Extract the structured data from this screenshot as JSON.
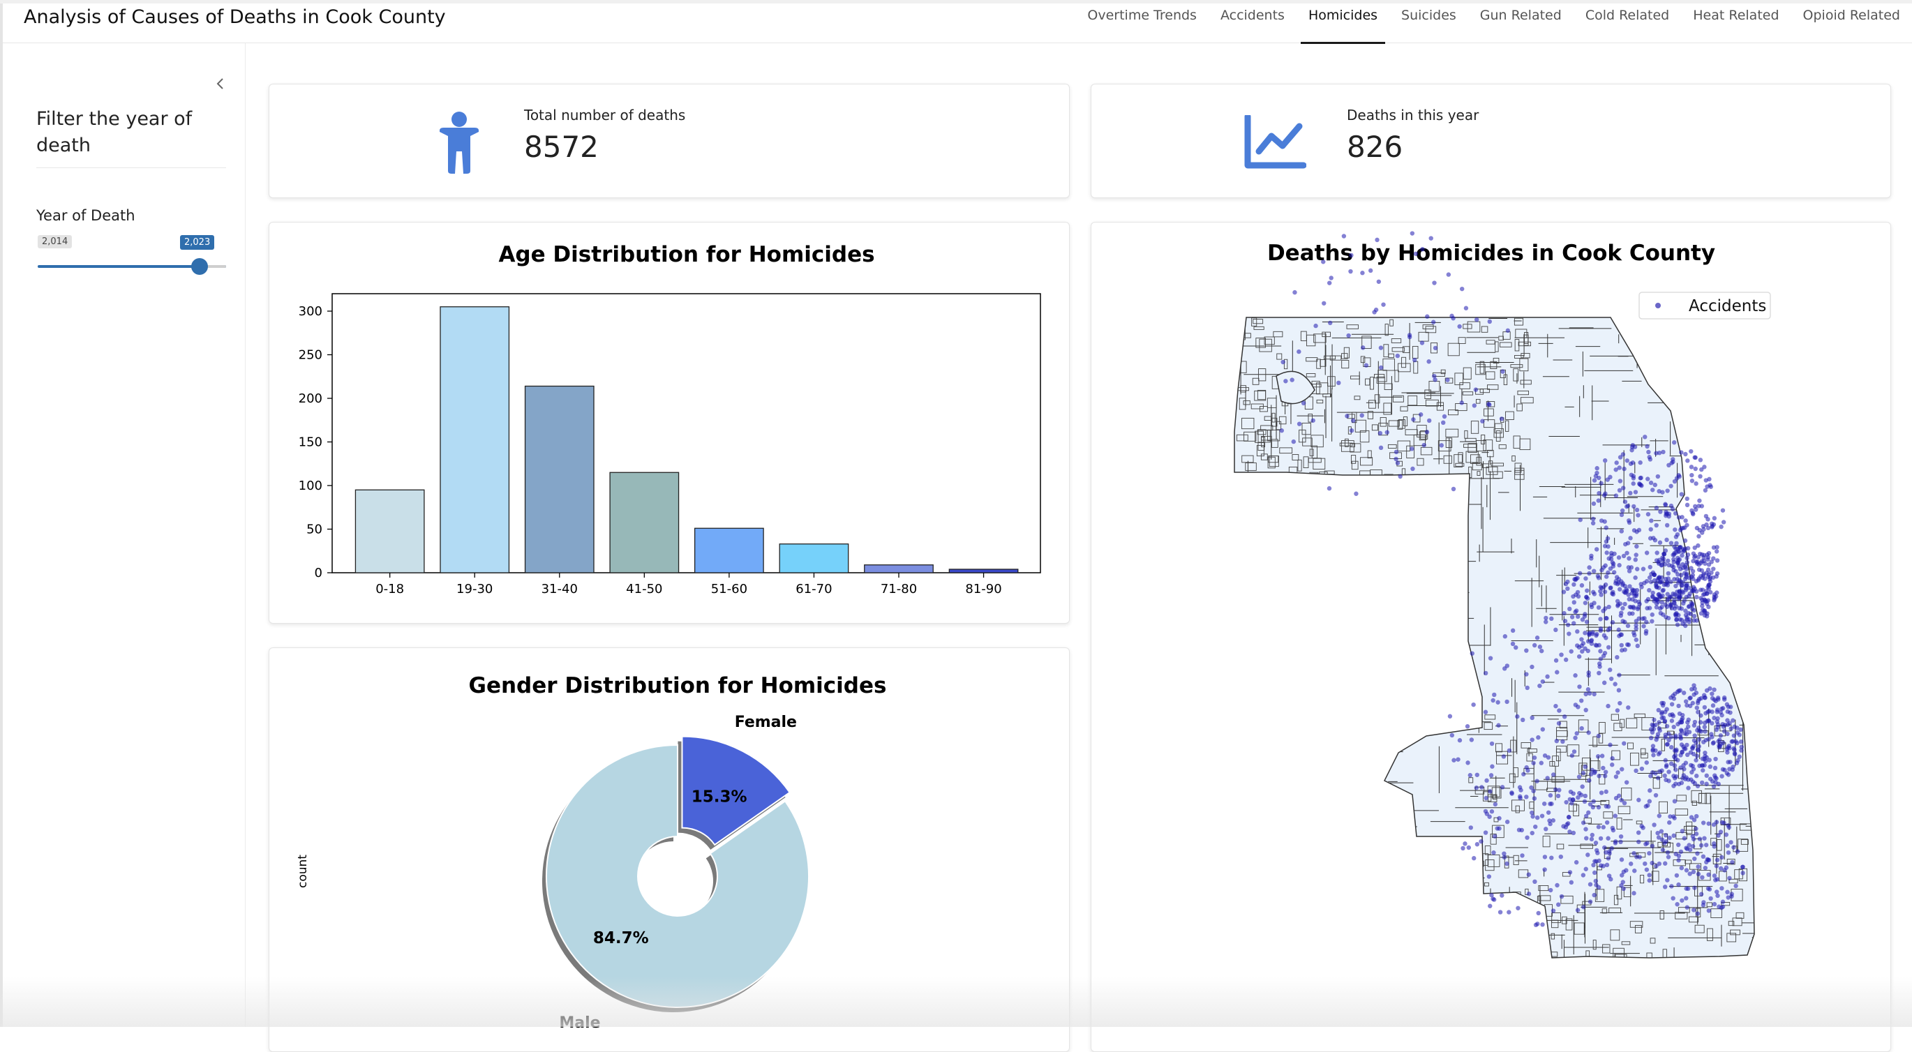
{
  "app": {
    "title": "Analysis of Causes of Deaths in Cook County"
  },
  "nav": {
    "tabs": [
      {
        "label": "Overtime Trends"
      },
      {
        "label": "Accidents"
      },
      {
        "label": "Homicides"
      },
      {
        "label": "Suicides"
      },
      {
        "label": "Gun Related"
      },
      {
        "label": "Cold Related"
      },
      {
        "label": "Heat Related"
      },
      {
        "label": "Opioid Related"
      }
    ],
    "active_tab": "Homicides"
  },
  "sidebar": {
    "collapse_icon": "chevron-left-icon",
    "title": "Filter the year of death",
    "slider": {
      "label": "Year of Death",
      "min_label": "2,014",
      "max_label": "2,023",
      "value": 2023,
      "min": 2014,
      "max": 2023
    }
  },
  "kpis": {
    "total": {
      "label": "Total number of deaths",
      "value": "8572",
      "icon": "person-icon"
    },
    "year": {
      "label": "Deaths in this year",
      "value": "826",
      "icon": "line-chart-icon"
    }
  },
  "colors": {
    "accent": "#2f6ead",
    "icon_blue": "#4a7dd8",
    "map_points": "#1f1ab0"
  },
  "chart_data": [
    {
      "type": "bar",
      "title": "Age Distribution for Homicides",
      "categories": [
        "0-18",
        "19-30",
        "31-40",
        "41-50",
        "51-60",
        "61-70",
        "71-80",
        "81-90"
      ],
      "values": [
        95,
        305,
        214,
        115,
        51,
        33,
        9,
        4
      ],
      "colors": [
        "#c9dfe8",
        "#b2dbf4",
        "#84a5c8",
        "#97b8b8",
        "#72aaf8",
        "#76d1fa",
        "#7b8ee0",
        "#3a48c8"
      ],
      "ylim": [
        0,
        320
      ],
      "yticks": [
        0,
        50,
        100,
        150,
        200,
        250,
        300
      ],
      "grid": false
    },
    {
      "type": "pie",
      "title": "Gender Distribution for Homicides",
      "ylabel": "count",
      "labels": [
        "Female",
        "Male"
      ],
      "values": [
        15.3,
        84.7
      ],
      "value_labels": [
        "15.3%",
        "84.7%"
      ],
      "colors": [
        "#4a63d8",
        "#b6d6e2"
      ],
      "donut": true
    },
    {
      "type": "scatter",
      "title": "Deaths by Homicides in Cook County",
      "legend": [
        "Accidents"
      ],
      "legend_position": "top-right"
    }
  ]
}
